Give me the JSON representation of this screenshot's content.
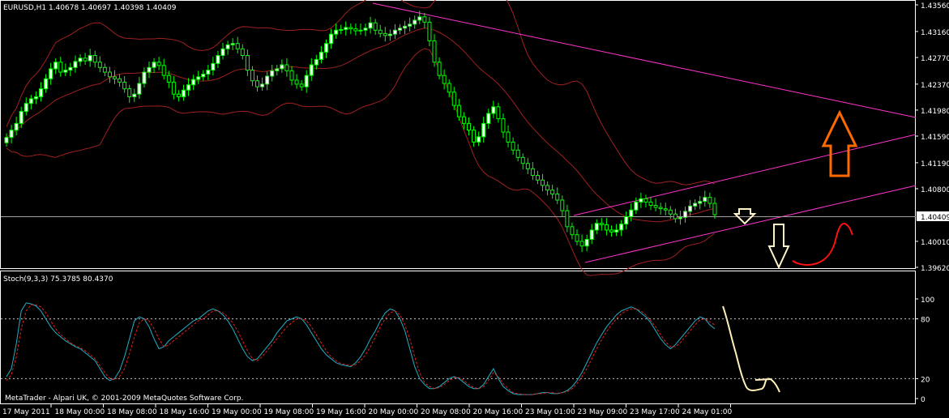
{
  "chart_info": {
    "symbol_line": "EURUSD,H1  1.40678 1.40697 1.40398 1.40409",
    "indicator_line": "Stoch(9,3,3) 75.3785 80.4370",
    "copyright": "MetaTrader - Alpari UK, © 2001-2009 MetaQuotes Software Corp.",
    "current_price": "1.40409"
  },
  "colors": {
    "background": "#000000",
    "frame": "#ffffff",
    "bull_candle": "#ffffff",
    "bear_candle": "#000000",
    "bullish_wick": "#00ff00",
    "bollinger": "#a02020",
    "trendline": "#ff33cc",
    "stoch_main": "#20b0c8",
    "stoch_signal": "#e02020",
    "arrow_up": "#ff6a00",
    "arrow_down": "#fff4c8",
    "sketch_red": "#ff1010",
    "sketch_cream": "#fff0b8"
  },
  "chart_data": [
    {
      "type": "candlestick",
      "title": "EURUSD,H1",
      "ylim": [
        1.3962,
        1.4356
      ],
      "y_ticks": [
        "1.43560",
        "1.43160",
        "1.42770",
        "1.42370",
        "1.41980",
        "1.41590",
        "1.41190",
        "1.40800",
        "1.40010",
        "1.39620"
      ],
      "x_ticks": [
        "17 May 2011",
        "18 May 00:00",
        "18 May 08:00",
        "18 May 16:00",
        "19 May 00:00",
        "19 May 08:00",
        "19 May 16:00",
        "20 May 00:00",
        "20 May 08:00",
        "20 May 16:00",
        "23 May 01:00",
        "23 May 09:00",
        "23 May 17:00",
        "24 May 01:00"
      ],
      "close": [
        1.4157,
        1.4168,
        1.4178,
        1.4196,
        1.4208,
        1.4215,
        1.4218,
        1.423,
        1.4245,
        1.426,
        1.427,
        1.4255,
        1.4258,
        1.4262,
        1.4271,
        1.4276,
        1.4272,
        1.428,
        1.427,
        1.4262,
        1.4255,
        1.4248,
        1.4245,
        1.424,
        1.423,
        1.4218,
        1.4222,
        1.4238,
        1.4255,
        1.4262,
        1.427,
        1.4265,
        1.425,
        1.424,
        1.4222,
        1.4218,
        1.4228,
        1.4236,
        1.4244,
        1.4248,
        1.4252,
        1.4258,
        1.4268,
        1.428,
        1.429,
        1.4296,
        1.4298,
        1.429,
        1.428,
        1.4258,
        1.4242,
        1.4233,
        1.4237,
        1.4249,
        1.4257,
        1.426,
        1.4266,
        1.4257,
        1.4243,
        1.4237,
        1.4233,
        1.425,
        1.4266,
        1.4274,
        1.4285,
        1.4298,
        1.4312,
        1.4318,
        1.4319,
        1.4322,
        1.432,
        1.4317,
        1.4318,
        1.4321,
        1.4329,
        1.4318,
        1.4313,
        1.431,
        1.4312,
        1.4318,
        1.4321,
        1.4324,
        1.4327,
        1.4333,
        1.4338,
        1.433,
        1.4302,
        1.427,
        1.425,
        1.4238,
        1.4225,
        1.4205,
        1.4188,
        1.4178,
        1.4168,
        1.415,
        1.4158,
        1.4178,
        1.4193,
        1.4203,
        1.4185,
        1.4165,
        1.415,
        1.4138,
        1.4127,
        1.4118,
        1.411,
        1.41,
        1.4093,
        1.4085,
        1.4078,
        1.4072,
        1.4063,
        1.4047,
        1.4023,
        1.4011,
        1.4001,
        1.3994,
        1.4004,
        1.4018,
        1.4028,
        1.4026,
        1.4018,
        1.4015,
        1.4018,
        1.4027,
        1.4038,
        1.4048,
        1.406,
        1.4065,
        1.406,
        1.4055,
        1.4052,
        1.405,
        1.4048,
        1.4042,
        1.4035,
        1.4037,
        1.4046,
        1.4054,
        1.4058,
        1.4061,
        1.4067,
        1.4058,
        1.4041
      ]
    },
    {
      "type": "line",
      "title": "Stoch(9,3,3)",
      "ylim": [
        0,
        100
      ],
      "y_ticks": [
        "100",
        "80",
        "20",
        "0"
      ],
      "levels": [
        80,
        20
      ],
      "series": [
        {
          "values": [
            22,
            30,
            55,
            88,
            96,
            95,
            93,
            88,
            80,
            72,
            66,
            62,
            58,
            55,
            52,
            50,
            46,
            42,
            38,
            30,
            22,
            18,
            20,
            28,
            42,
            60,
            78,
            82,
            80,
            72,
            60,
            50,
            52,
            58,
            62,
            66,
            70,
            74,
            78,
            80,
            84,
            88,
            90,
            88,
            84,
            78,
            70,
            60,
            50,
            42,
            38,
            40,
            46,
            52,
            58,
            66,
            72,
            78,
            80,
            82,
            80,
            74,
            66,
            58,
            50,
            44,
            40,
            36,
            34,
            33,
            32,
            36,
            42,
            50,
            60,
            68,
            78,
            86,
            90,
            88,
            80,
            68,
            50,
            32,
            20,
            14,
            10,
            10,
            12,
            16,
            20,
            22,
            20,
            16,
            12,
            10,
            10,
            14,
            22,
            30,
            20,
            12,
            8,
            5,
            4,
            4,
            4,
            4,
            5,
            6,
            6,
            5,
            5,
            6,
            8,
            12,
            18,
            26,
            36,
            46,
            56,
            64,
            72,
            78,
            84,
            88,
            90,
            92,
            90,
            86,
            82,
            76,
            68,
            60,
            54,
            50,
            54,
            60,
            66,
            72,
            78,
            82,
            80,
            74,
            70
          ]
        },
        {
          "values": [
            18,
            24,
            42,
            70,
            88,
            94,
            94,
            92,
            86,
            78,
            70,
            64,
            60,
            56,
            53,
            51,
            48,
            44,
            40,
            33,
            26,
            20,
            19,
            22,
            30,
            45,
            62,
            76,
            80,
            78,
            70,
            60,
            52,
            54,
            58,
            62,
            66,
            70,
            74,
            78,
            80,
            84,
            88,
            88,
            86,
            82,
            76,
            68,
            58,
            48,
            40,
            38,
            42,
            48,
            54,
            60,
            66,
            72,
            76,
            80,
            80,
            78,
            72,
            64,
            56,
            48,
            42,
            38,
            35,
            34,
            33,
            34,
            38,
            44,
            52,
            62,
            72,
            80,
            86,
            88,
            84,
            74,
            60,
            42,
            26,
            16,
            12,
            10,
            11,
            14,
            18,
            21,
            21,
            18,
            14,
            11,
            10,
            12,
            18,
            26,
            22,
            15,
            10,
            6,
            5,
            4,
            4,
            4,
            5,
            5,
            6,
            6,
            5,
            6,
            7,
            10,
            15,
            22,
            30,
            40,
            50,
            59,
            67,
            74,
            80,
            85,
            88,
            90,
            90,
            88,
            84,
            78,
            72,
            64,
            57,
            52,
            52,
            56,
            62,
            68,
            74,
            79,
            80,
            77,
            74
          ]
        }
      ]
    }
  ]
}
